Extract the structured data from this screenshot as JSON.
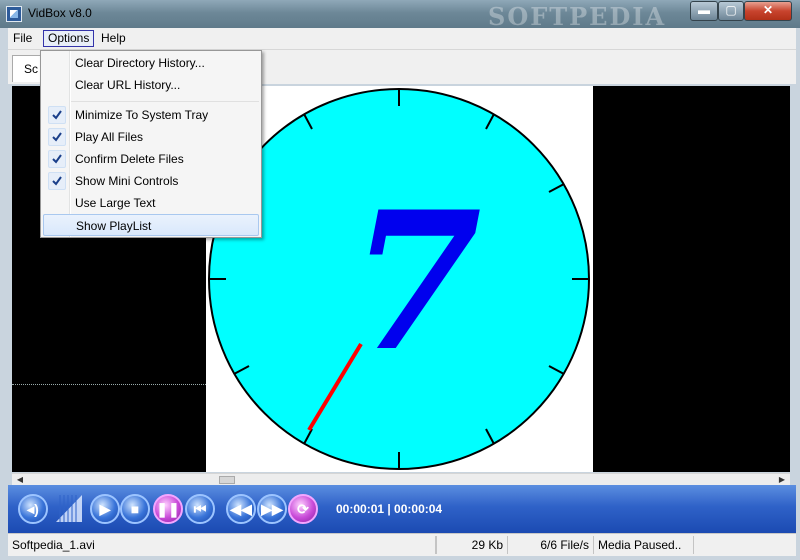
{
  "window": {
    "title": "VidBox v8.0",
    "watermark": "SOFTPEDIA"
  },
  "title_buttons": {
    "minimize": "▬",
    "maximize": "▢",
    "close": "✕"
  },
  "menubar": {
    "file": "File",
    "options": "Options",
    "help": "Help"
  },
  "tab": {
    "label": "Sc"
  },
  "options_menu": {
    "items": [
      {
        "label": "Clear Directory History...",
        "checked": false
      },
      {
        "label": "Clear URL History...",
        "checked": false
      },
      {
        "label": "Minimize To System Tray",
        "checked": true
      },
      {
        "label": "Play All Files",
        "checked": true
      },
      {
        "label": "Confirm Delete Files",
        "checked": true
      },
      {
        "label": "Show Mini Controls",
        "checked": true
      },
      {
        "label": "Use Large Text",
        "checked": false
      },
      {
        "label": "Show PlayList",
        "checked": false,
        "highlighted": true
      }
    ]
  },
  "video": {
    "digit": "7",
    "dial_color": "#00ffff",
    "digit_color": "#0000ee",
    "hand_color": "#ff0000"
  },
  "controls": {
    "time": "00:00:01 | 00:00:04",
    "buttons": {
      "audio": "◂)",
      "play": "▶",
      "stop": "■",
      "pause": "❚❚",
      "prev": "⏮",
      "rewind": "◀◀",
      "forward": "▶▶",
      "repeat": "⟳"
    }
  },
  "status": {
    "file": "Softpedia_1.avi",
    "size": "29 Kb",
    "rate": "6/6 File/s",
    "state": "Media Paused.."
  }
}
